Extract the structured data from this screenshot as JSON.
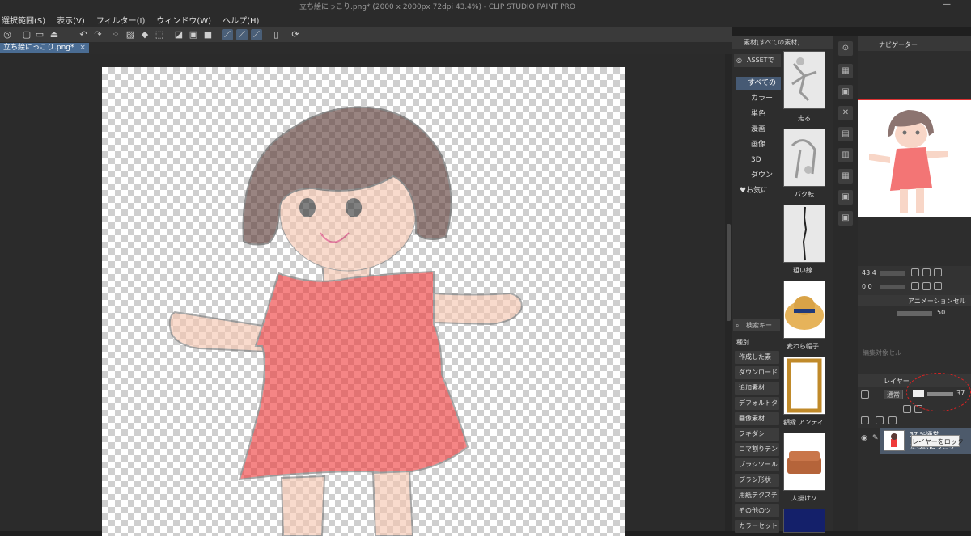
{
  "window": {
    "title": "立ち絵にっこり.png* (2000 x 2000px 72dpi 43.4%)  - CLIP STUDIO PAINT PRO"
  },
  "menu": [
    "選択範囲(S)",
    "表示(V)",
    "フィルター(I)",
    "ウィンドウ(W)",
    "ヘルプ(H)"
  ],
  "document_tab": {
    "label": "立ち絵にっこり.png*",
    "close": "×"
  },
  "material_panel": {
    "header": "素材[すべての素材]",
    "asset_button": "ASSETで",
    "tree": [
      "すべての",
      "カラー",
      "単色",
      "漫画",
      "画像",
      "3D",
      "ダウン",
      "お気に"
    ],
    "search_placeholder": "検索キー",
    "kind_label": "種別",
    "categories": [
      "作成した素",
      "ダウンロード",
      "追加素材",
      "デフォルトタ",
      "画像素材",
      "フキダシ",
      "コマ割りテン",
      "ブラシツール",
      "ブラシ形状",
      "用紙テクスチ",
      "その他のツ",
      "カラーセット"
    ],
    "thumbnails": [
      "走る",
      "バク転",
      "粗い線",
      "麦わら帽子",
      "額縁 アンティ",
      "二人掛けソ"
    ]
  },
  "navigator": {
    "tab_label": "ナビゲーター",
    "zoom": "43.4",
    "angle": "0.0"
  },
  "animation": {
    "tab_label": "アニメーションセル",
    "opacity": "50",
    "edit_target": "編集対象セル"
  },
  "layer_panel": {
    "tab_label": "レイヤー",
    "blend_mode": "通常",
    "opacity": "37",
    "tooltip": "レイヤーをロック",
    "layer": {
      "info": "37 %通常",
      "name": "立ち絵にっこり"
    }
  },
  "colors": {
    "accent": "#4a6c93",
    "annotation": "#dd2222"
  }
}
